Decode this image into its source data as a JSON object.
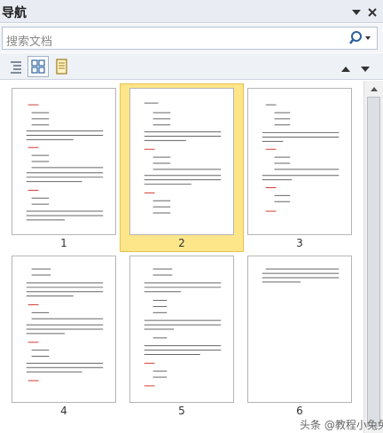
{
  "window": {
    "title": "导航"
  },
  "search": {
    "placeholder": "搜索文档"
  },
  "pages": [
    {
      "number": "1"
    },
    {
      "number": "2",
      "selected": true
    },
    {
      "number": "3"
    },
    {
      "number": "4"
    },
    {
      "number": "5"
    },
    {
      "number": "6"
    }
  ],
  "watermark": "头条 @教程小兔兔",
  "colors": {
    "selection_fill": "#fde58a",
    "selection_border": "#e6c24a",
    "heading_red": "#d23b2f",
    "panel_bg": "#e9edf3"
  }
}
